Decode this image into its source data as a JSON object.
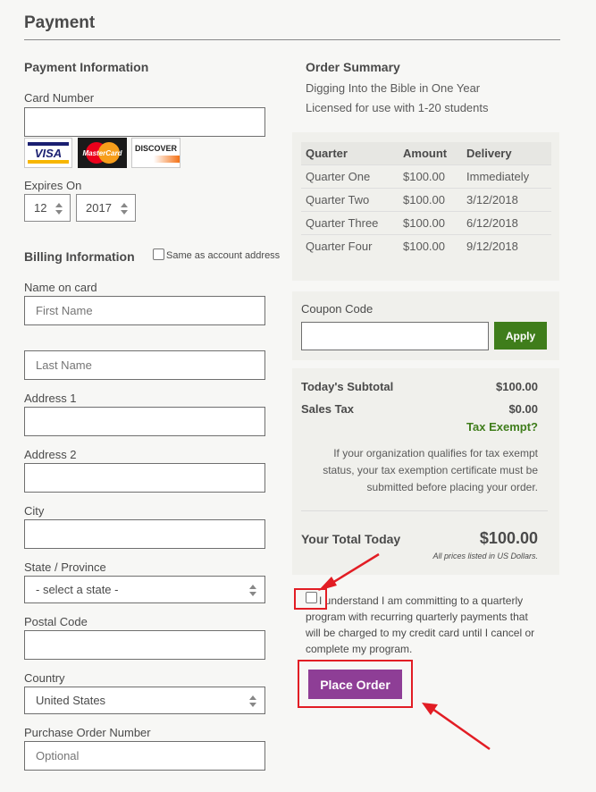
{
  "page": {
    "title": "Payment"
  },
  "payment_info": {
    "heading": "Payment Information",
    "card_number_label": "Card Number",
    "card_number_value": "",
    "cards": [
      "VISA",
      "MasterCard",
      "DISCOVER"
    ],
    "expires_label": "Expires On",
    "exp_month": "12",
    "exp_year": "2017"
  },
  "billing": {
    "heading": "Billing Information",
    "same_as_account_label": "Same as account address",
    "name_on_card_label": "Name on card",
    "first_name_placeholder": "First Name",
    "last_name_placeholder": "Last Name",
    "address1_label": "Address 1",
    "address2_label": "Address 2",
    "city_label": "City",
    "state_label": "State / Province",
    "state_value": "- select a state -",
    "postal_label": "Postal Code",
    "country_label": "Country",
    "country_value": "United States",
    "po_label": "Purchase Order Number",
    "po_placeholder": "Optional"
  },
  "order_summary": {
    "heading": "Order Summary",
    "product": "Digging Into the Bible in One Year",
    "license": "Licensed for use with 1-20 students",
    "columns": [
      "Quarter",
      "Amount",
      "Delivery"
    ],
    "rows": [
      [
        "Quarter One",
        "$100.00",
        "Immediately"
      ],
      [
        "Quarter Two",
        "$100.00",
        "3/12/2018"
      ],
      [
        "Quarter Three",
        "$100.00",
        "6/12/2018"
      ],
      [
        "Quarter Four",
        "$100.00",
        "9/12/2018"
      ]
    ]
  },
  "coupon": {
    "label": "Coupon Code",
    "apply_label": "Apply",
    "value": ""
  },
  "totals": {
    "subtotal_label": "Today's Subtotal",
    "subtotal_value": "$100.00",
    "tax_label": "Sales Tax",
    "tax_value": "$0.00",
    "tax_exempt_link": "Tax Exempt?",
    "tax_note": "If your organization qualifies for tax exempt status, your tax exemption certificate must be submitted before placing your order.",
    "total_label": "Your Total Today",
    "total_value": "$100.00",
    "currency_note": "All prices listed in US Dollars."
  },
  "agreement": {
    "text": "I understand I am committing to a quarterly program with recurring quarterly payments that will be charged to my credit card until I cancel or complete my program."
  },
  "place_order_label": "Place Order",
  "colors": {
    "apply_green": "#3f7d1b",
    "place_purple": "#8e3e96",
    "annotation_red": "#e21d24",
    "tax_link_green": "#3f7d1b"
  }
}
